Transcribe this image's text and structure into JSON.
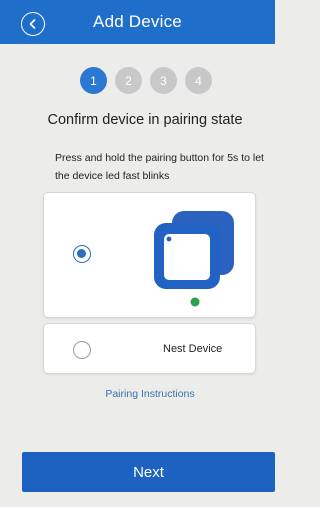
{
  "header": {
    "title": "Add Device",
    "back_icon": "chevron-left-icon"
  },
  "steps": {
    "items": [
      "1",
      "2",
      "3",
      "4"
    ],
    "active_index": 0
  },
  "main": {
    "title": "Confirm device in pairing state",
    "instructions": "Press and hold the pairing button for 5s to let the device led fast blinks"
  },
  "options": [
    {
      "selected": true,
      "icon": "device-led-icon",
      "label": ""
    },
    {
      "selected": false,
      "label": "Nest Device"
    }
  ],
  "links": {
    "pairing_instructions": "Pairing Instructions"
  },
  "footer": {
    "next_label": "Next"
  },
  "colors": {
    "primary": "#1f6ec9",
    "step_inactive": "#c8c8ca",
    "led_green": "#2e9e4f"
  }
}
